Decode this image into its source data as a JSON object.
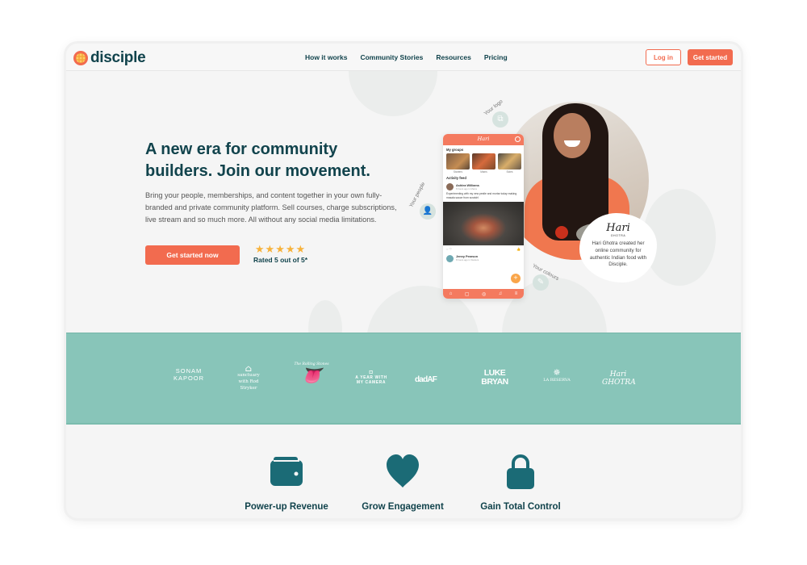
{
  "nav": {
    "brand": "disciple",
    "links": [
      "How it works",
      "Community Stories",
      "Resources",
      "Pricing"
    ],
    "login_label": "Log in",
    "get_started_label": "Get started"
  },
  "hero": {
    "title": "A new era for community builders. Join our movement.",
    "description": "Bring your people, memberships, and content together in your own fully-branded and private community platform. Sell courses, charge subscriptions, live stream and so much more. All without any social media limitations.",
    "cta_label": "Get started now",
    "stars": "★★★★★",
    "rating": 5,
    "rating_max": 5,
    "rating_label": "Rated 5 out of 5*"
  },
  "showcase": {
    "annotations": {
      "logo": "Your logo",
      "people": "Your people",
      "colours": "Your colours"
    },
    "phone": {
      "brand": "Hari",
      "groups_heading": "My groups",
      "groups": [
        "Starters",
        "Mains",
        "Sides"
      ],
      "feed_heading": "Activity feed",
      "post": {
        "author": "Ashlea Williams",
        "meta": "6 hours ago in Mains",
        "text": "Experimenting with my new pestle and mortar today making masala sauce from scratch!"
      },
      "post2": {
        "author": "Jenny Pearson",
        "meta": "8 hours ago in Starters"
      },
      "fab": "+"
    },
    "card": {
      "logo": "Hari",
      "sub": "GHOTRA",
      "text": "Hari Ghotra created her online community for authentic Indian food with Disciple."
    }
  },
  "brands": [
    "SONAM KAPOOR",
    "sanctuary with Rod Stryker",
    "The Rolling Stones",
    "A YEAR WITH MY CAMERA",
    "dadAF",
    "LUKE BRYAN",
    "LA RESERVA",
    "Hari GHOTRA"
  ],
  "features": [
    {
      "icon": "wallet-icon",
      "label": "Power-up Revenue"
    },
    {
      "icon": "heart-icon",
      "label": "Grow Engagement"
    },
    {
      "icon": "lock-icon",
      "label": "Gain Total Control"
    }
  ],
  "colors": {
    "brand_orange": "#f26b4f",
    "dark_teal": "#11434c",
    "icon_teal": "#1b6b76",
    "band_teal": "#88c5b9",
    "star": "#f7b23b"
  }
}
